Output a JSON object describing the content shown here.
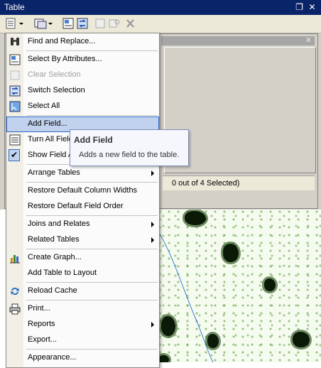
{
  "window": {
    "title": "Table"
  },
  "titlebar": {
    "restore_glyph": "❐",
    "close_glyph": "✕"
  },
  "toolbar": {
    "icons": [
      "table-options-icon",
      "related-tables-icon",
      "select-by-attributes-icon",
      "switch-selection-icon",
      "clear-selection-icon",
      "zoom-to-selected-icon",
      "delete-selected-icon"
    ]
  },
  "status": {
    "text": "0 out of 4 Selected)"
  },
  "menu": {
    "find_replace": "Find and Replace...",
    "select_by_attributes": "Select By Attributes...",
    "clear_selection": "Clear Selection",
    "switch_selection": "Switch Selection",
    "select_all": "Select All",
    "add_field": "Add Field...",
    "turn_all_fields_on": "Turn All Fields On",
    "show_field_aliases": "Show Field Aliases",
    "arrange_tables": "Arrange Tables",
    "restore_column_widths": "Restore Default Column Widths",
    "restore_field_order": "Restore Default Field Order",
    "joins_relates": "Joins and Relates",
    "related_tables": "Related Tables",
    "create_graph": "Create Graph...",
    "add_table_to_layout": "Add Table to Layout",
    "reload_cache": "Reload Cache",
    "print": "Print...",
    "reports": "Reports",
    "export": "Export...",
    "appearance": "Appearance...",
    "check_glyph": "✔"
  },
  "tooltip": {
    "title": "Add Field",
    "description": "Adds a new field to the table."
  },
  "colors": {
    "titlebar": "#0a246a",
    "highlight": "#c1d2ee",
    "highlight_border": "#316ac5",
    "map_tree": "#0b1a06",
    "map_line": "#3a7fd5"
  }
}
